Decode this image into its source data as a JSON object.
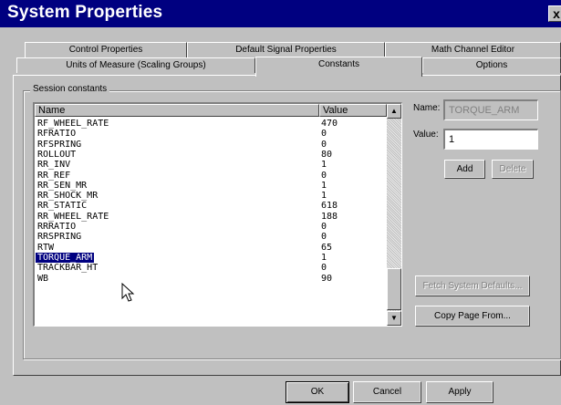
{
  "window": {
    "title": "System Properties",
    "close_label": "x"
  },
  "tabs_row1": [
    {
      "label": "Control Properties"
    },
    {
      "label": "Default Signal Properties"
    },
    {
      "label": "Math Channel Editor"
    }
  ],
  "tabs_row2": [
    {
      "label": "Units of Measure (Scaling Groups)"
    },
    {
      "label": "Constants",
      "selected": true
    },
    {
      "label": "Options"
    }
  ],
  "group": {
    "label": "Session constants"
  },
  "list": {
    "columns": [
      "Name",
      "Value"
    ],
    "rows": [
      {
        "name": "RF_WHEEL_RATE",
        "value": "470"
      },
      {
        "name": "RFRATIO",
        "value": "0"
      },
      {
        "name": "RFSPRING",
        "value": "0"
      },
      {
        "name": "ROLLOUT",
        "value": "80"
      },
      {
        "name": "RR_INV",
        "value": "1"
      },
      {
        "name": "RR_REF",
        "value": "0"
      },
      {
        "name": "RR_SEN_MR",
        "value": "1"
      },
      {
        "name": "RR_SHOCK_MR",
        "value": "1"
      },
      {
        "name": "RR_STATIC",
        "value": "618"
      },
      {
        "name": "RR_WHEEL_RATE",
        "value": "188"
      },
      {
        "name": "RRRATIO",
        "value": "0"
      },
      {
        "name": "RRSPRING",
        "value": "0"
      },
      {
        "name": "RTW",
        "value": "65"
      },
      {
        "name": "TORQUE_ARM",
        "value": "1",
        "selected": true
      },
      {
        "name": "TRACKBAR_HT",
        "value": "0"
      },
      {
        "name": "WB",
        "value": "90"
      }
    ]
  },
  "form": {
    "name_label": "Name:",
    "name_value": "TORQUE_ARM",
    "value_label": "Value:",
    "value_value": "1",
    "add_label": "Add",
    "delete_label": "Delete",
    "fetch_label": "Fetch System Defaults...",
    "copy_label": "Copy Page From..."
  },
  "footer": {
    "ok_label": "OK",
    "cancel_label": "Cancel",
    "apply_label": "Apply"
  },
  "colors": {
    "face": "#c0c0c0",
    "titlebar": "#000080",
    "selection": "#000080"
  }
}
